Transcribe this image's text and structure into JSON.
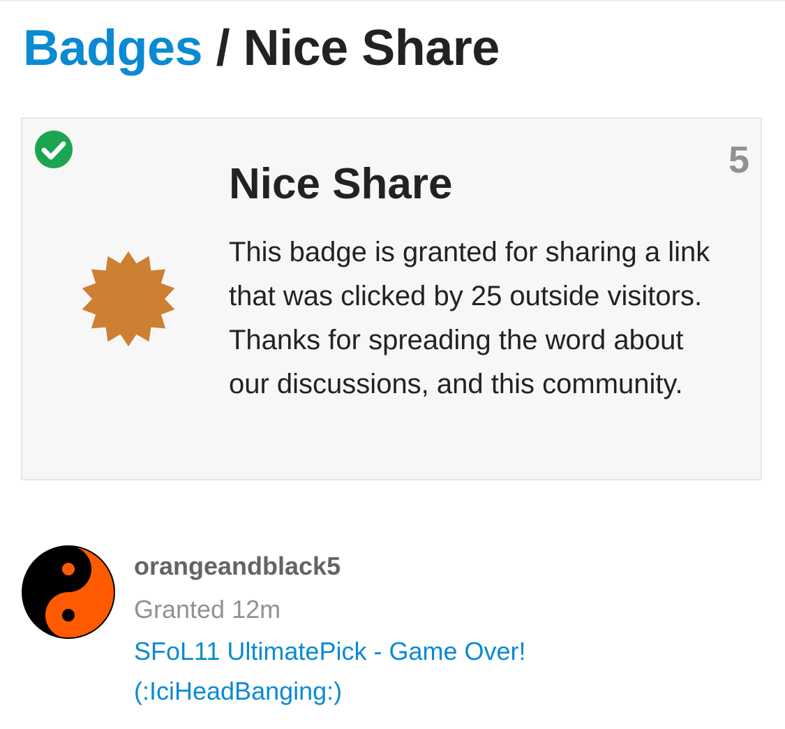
{
  "header": {
    "breadcrumb_root": "Badges",
    "separator": "/",
    "current": "Nice Share"
  },
  "badge": {
    "name": "Nice Share",
    "grant_count": "5",
    "description": "This badge is granted for sharing a link that was clicked by 25 outside visitors. Thanks for spreading the word about our discussions, and this community.",
    "icon": "bronze-badge-icon",
    "icon_color": "#cd7f32",
    "owned_icon": "check-circle-icon",
    "owned_color": "#1ca551"
  },
  "grants": [
    {
      "username": "orangeandblack5",
      "granted": "Granted 12m",
      "topic": "SFoL11 UltimatePick - Game Over! (:IciHeadBanging:)",
      "avatar": "yin-yang-avatar",
      "avatar_colors": [
        "#000000",
        "#ff5a00"
      ]
    }
  ],
  "colors": {
    "link": "#0a8ad2",
    "text": "#222222",
    "muted": "#919191",
    "card_bg": "#f7f7f7"
  }
}
